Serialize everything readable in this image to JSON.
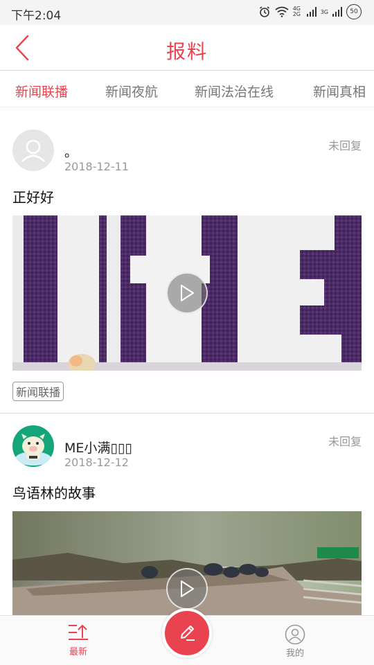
{
  "status_bar": {
    "time": "下午2:04",
    "network_1": "4G 2G",
    "network_2": "3G",
    "battery": "50",
    "icons": [
      "alarm-icon",
      "wifi-icon",
      "signal-icon",
      "signal-icon",
      "battery-icon"
    ]
  },
  "header": {
    "title": "报料",
    "back_icon": "chevron-left-icon",
    "accent_color": "#e8434f"
  },
  "tabs": [
    {
      "label": "新闻联播",
      "active": true
    },
    {
      "label": "新闻夜航",
      "active": false
    },
    {
      "label": "新闻法治在线",
      "active": false
    },
    {
      "label": "新闻真相",
      "active": false
    }
  ],
  "posts": [
    {
      "username": "。",
      "date": "2018-12-11",
      "reply_status": "未回复",
      "text": "正好好",
      "tag": "新闻联播",
      "video_icon": "play-icon"
    },
    {
      "username": "ME小满▯▯▯",
      "date": "2018-12-12",
      "reply_status": "未回复",
      "text": "鸟语林的故事",
      "video_icon": "play-icon"
    }
  ],
  "bottom_nav": {
    "latest_label": "最新",
    "mine_label": "我的",
    "compose_icon": "pencil-icon"
  }
}
